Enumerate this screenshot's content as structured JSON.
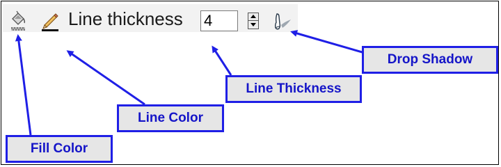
{
  "toolbar": {
    "fill_color_icon": "paint-bucket-icon",
    "line_color_icon": "pencil-icon",
    "line_thickness_label": "Line thickness",
    "line_thickness_value": "4",
    "stepper_icon": "spin-arrows-icon",
    "drop_shadow_icon": "drop-shadow-icon"
  },
  "callouts": {
    "drop_shadow": "Drop Shadow",
    "line_thickness": "Line Thickness",
    "line_color": "Line Color",
    "fill_color": "Fill Color"
  },
  "colors": {
    "callout_border": "#1f1fe6",
    "callout_text": "#1515c8",
    "callout_bg": "#e6e6e6",
    "toolbar_bg": "#f2f2f2"
  }
}
